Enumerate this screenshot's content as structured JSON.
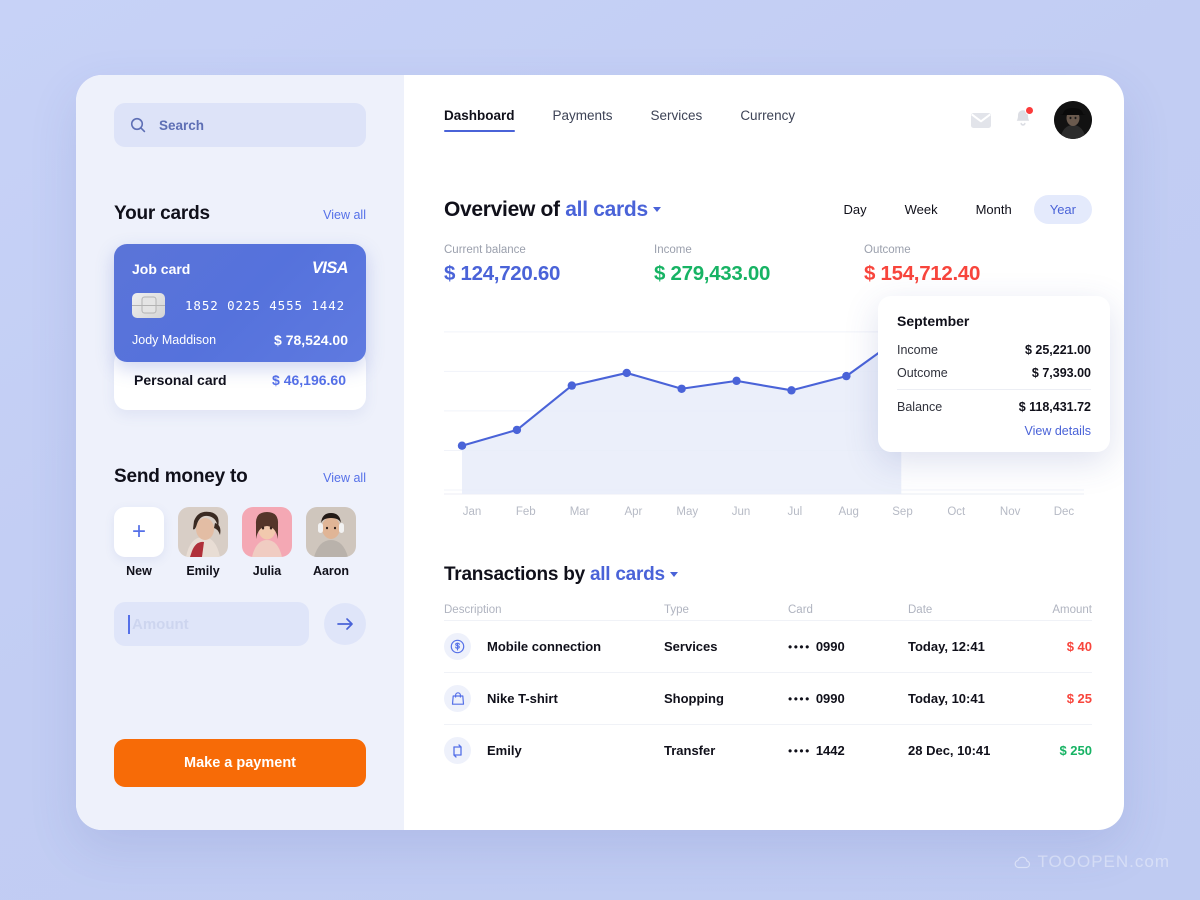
{
  "sidebar": {
    "search": {
      "placeholder": "Search",
      "icon": "search-icon"
    },
    "cards_section": {
      "title": "Your cards",
      "view_all": "View all"
    },
    "job_card": {
      "label": "Job card",
      "brand": "VISA",
      "number": "1852 0225 4555 1442",
      "holder": "Jody Maddison",
      "amount": "$ 78,524.00"
    },
    "personal_card": {
      "label": "Personal card",
      "amount": "$ 46,196.60"
    },
    "send_section": {
      "title": "Send money to",
      "view_all": "View all"
    },
    "people": [
      {
        "name": "New",
        "type": "add"
      },
      {
        "name": "Emily",
        "type": "photo"
      },
      {
        "name": "Julia",
        "type": "photo"
      },
      {
        "name": "Aaron",
        "type": "photo"
      }
    ],
    "amount_input": {
      "placeholder": "Amount",
      "value": ""
    },
    "send_button_icon": "arrow-right-icon",
    "pay_button": "Make a payment"
  },
  "header": {
    "tabs": [
      {
        "label": "Dashboard",
        "active": true
      },
      {
        "label": "Payments",
        "active": false
      },
      {
        "label": "Services",
        "active": false
      },
      {
        "label": "Currency",
        "active": false
      }
    ],
    "icons": [
      "mail-icon",
      "bell-icon",
      "avatar"
    ],
    "notification_badge": true
  },
  "overview": {
    "title_prefix": "Overview of",
    "title_link": "all cards",
    "ranges": [
      {
        "label": "Day",
        "active": false
      },
      {
        "label": "Week",
        "active": false
      },
      {
        "label": "Month",
        "active": false
      },
      {
        "label": "Year",
        "active": true
      }
    ],
    "stats": [
      {
        "label": "Current balance",
        "value": "$ 124,720.60",
        "color": "#4a63d8"
      },
      {
        "label": "Income",
        "value": "$ 279,433.00",
        "color": "#17b364"
      },
      {
        "label": "Outcome",
        "value": "$ 154,712.40",
        "color": "#f8453c"
      }
    ]
  },
  "tooltip": {
    "title": "September",
    "rows": [
      {
        "key": "Income",
        "value": "$ 25,221.00"
      },
      {
        "key": "Outcome",
        "value": "$ 7,393.00"
      }
    ],
    "balance": {
      "key": "Balance",
      "value": "$ 118,431.72"
    },
    "link": "View details"
  },
  "chart_data": {
    "type": "line",
    "title": "Overview of all cards",
    "xlabel": "",
    "ylabel": "",
    "grid": true,
    "legend": "none",
    "categories": [
      "Jan",
      "Feb",
      "Mar",
      "Apr",
      "May",
      "Jun",
      "Jul",
      "Aug",
      "Sep",
      "Oct",
      "Nov",
      "Dec"
    ],
    "x": [
      "Jan",
      "Feb",
      "Mar",
      "Apr",
      "May",
      "Jun",
      "Jul",
      "Aug",
      "Sep",
      "Oct",
      "Nov",
      "Dec"
    ],
    "series": [
      {
        "name": "Balance",
        "values": [
          28,
          38,
          66,
          74,
          64,
          69,
          63,
          72,
          97,
          null,
          null,
          null
        ]
      }
    ],
    "ylim": [
      0,
      110
    ],
    "highlight_point": {
      "category": "Sep",
      "value": 97,
      "label": "September"
    },
    "line_color": "#4a63d8",
    "area_fill": "#e8ecf9"
  },
  "transactions": {
    "title_prefix": "Transactions by",
    "title_link": "all cards",
    "columns": [
      "Description",
      "Type",
      "Card",
      "Date",
      "Amount"
    ],
    "rows": [
      {
        "icon": "dollar-circle-icon",
        "description": "Mobile connection",
        "type": "Services",
        "card_dots": "••••",
        "card": "0990",
        "date": "Today, 12:41",
        "amount": "$ 40",
        "amount_color": "#f8453c"
      },
      {
        "icon": "shopping-bag-icon",
        "description": "Nike T-shirt",
        "type": "Shopping",
        "card_dots": "••••",
        "card": "0990",
        "date": "Today, 10:41",
        "amount": "$ 25",
        "amount_color": "#f8453c"
      },
      {
        "icon": "transfer-icon",
        "description": "Emily",
        "type": "Transfer",
        "card_dots": "••••",
        "card": "1442",
        "date": "28 Dec, 10:41",
        "amount": "$ 250",
        "amount_color": "#17b364"
      }
    ]
  },
  "watermark": "TOOOPEN.com",
  "colors": {
    "accent": "#4a63d8",
    "orange": "#f76b07",
    "green": "#17b364",
    "red": "#f8453c",
    "sidebar_bg": "#eef1fb",
    "page_bg": "#c3cff4"
  }
}
